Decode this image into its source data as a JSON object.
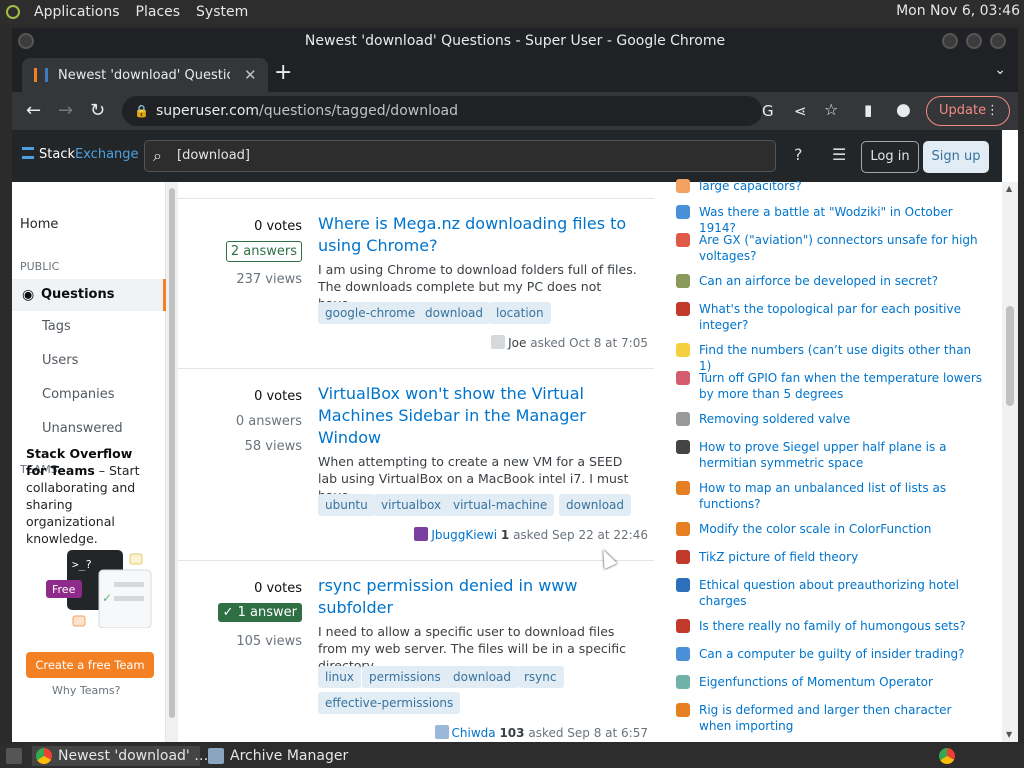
{
  "os_panel": {
    "menus": [
      "Applications",
      "Places",
      "System"
    ],
    "clock": "Mon Nov 6, 03:46"
  },
  "window": {
    "title": "Newest 'download' Questions - Super User - Google Chrome"
  },
  "browser": {
    "tab_title": "Newest 'download' Questions",
    "url_host": "superuser.com",
    "url_path": "/questions/tagged/download",
    "update_label": "Update"
  },
  "se_header": {
    "logo_stack": "Stack",
    "logo_exchange": "Exchange",
    "search_value": "[download]",
    "login_label": "Log in",
    "signup_label": "Sign up"
  },
  "leftnav": {
    "home": "Home",
    "public_heading": "PUBLIC",
    "questions": "Questions",
    "tags": "Tags",
    "users": "Users",
    "companies": "Companies",
    "unanswered": "Unanswered",
    "teams_heading": "TEAMS",
    "teams_title": "Stack Overflow for Teams",
    "teams_text": " – Start collaborating and sharing organizational knowledge.",
    "free_badge": "Free",
    "create_team": "Create a free Team",
    "why_teams": "Why Teams?"
  },
  "questions": [
    {
      "votes": "0 votes",
      "answers": "2 answers",
      "views": "237 views",
      "title": "Where is Mega.nz downloading files to using Chrome?",
      "excerpt": "I am using Chrome to download folders full of files. The downloads complete but my PC does not have…",
      "tags": [
        "google-chrome",
        "download",
        "location"
      ],
      "user": "Joe",
      "rep": "",
      "asked": "asked Oct 8 at 7:05"
    },
    {
      "votes": "0 votes",
      "answers": "0 answers",
      "views": "58 views",
      "title": "VirtualBox won't show the Virtual Machines Sidebar in the Manager Window",
      "excerpt": "When attempting to create a new VM for a SEED lab using VirtualBox on a MacBook intel i7. I must have …",
      "tags": [
        "ubuntu",
        "virtualbox",
        "virtual-machine",
        "download"
      ],
      "user": "JbuggKiewi",
      "rep": "1",
      "asked": "asked Sep 22 at 22:46"
    },
    {
      "votes": "0 votes",
      "answers": "1 answer",
      "views": "105 views",
      "title": "rsync permission denied in www subfolder",
      "excerpt": "I need to allow a specific user to download files from my web server. The files will be in a specific directory…",
      "tags": [
        "linux",
        "permissions",
        "download",
        "rsync",
        "effective-permissions"
      ],
      "user": "Chiwda",
      "rep": "103",
      "asked": "asked Sep 8 at 6:57"
    }
  ],
  "hnq": [
    {
      "title": "large capacitors?",
      "color": "#f4a261"
    },
    {
      "title": "Was there a battle at \"Wodziki\" in October 1914?",
      "color": "#4a90d9"
    },
    {
      "title": "Are GX (\"aviation\") connectors unsafe for high voltages?",
      "color": "#e05a4a"
    },
    {
      "title": "Can an airforce be developed in secret?",
      "color": "#8a9a5b"
    },
    {
      "title": "What's the topological par for each positive integer?",
      "color": "#c0392b"
    },
    {
      "title": "Find the numbers (can’t use digits other than 1)",
      "color": "#f4d03f"
    },
    {
      "title": "Turn off GPIO fan when the temperature lowers by more than 5 degrees",
      "color": "#d35d6e"
    },
    {
      "title": "Removing soldered valve",
      "color": "#999999"
    },
    {
      "title": "How to prove Siegel upper half plane is a hermitian symmetric space",
      "color": "#444444"
    },
    {
      "title": "How to map an unbalanced list of lists as functions?",
      "color": "#e67e22"
    },
    {
      "title": "Modify the color scale in ColorFunction",
      "color": "#e67e22"
    },
    {
      "title": "TikZ picture of field theory",
      "color": "#c0392b"
    },
    {
      "title": "Ethical question about preauthorizing hotel charges",
      "color": "#2c6fbb"
    },
    {
      "title": "Is there really no family of humongous sets?",
      "color": "#c0392b"
    },
    {
      "title": "Can a computer be guilty of insider trading?",
      "color": "#4a90d9"
    },
    {
      "title": "Eigenfunctions of Momentum Operator",
      "color": "#6fb3a8"
    },
    {
      "title": "Rig is deformed and larger then character when importing",
      "color": "#e67e22"
    }
  ],
  "taskbar": {
    "task_chrome": "Newest 'download' …",
    "task_archive": "Archive Manager"
  },
  "colors": {
    "accent_orange": "#f48024",
    "link_blue": "#0074cc",
    "answered_green": "#2f6f44"
  }
}
